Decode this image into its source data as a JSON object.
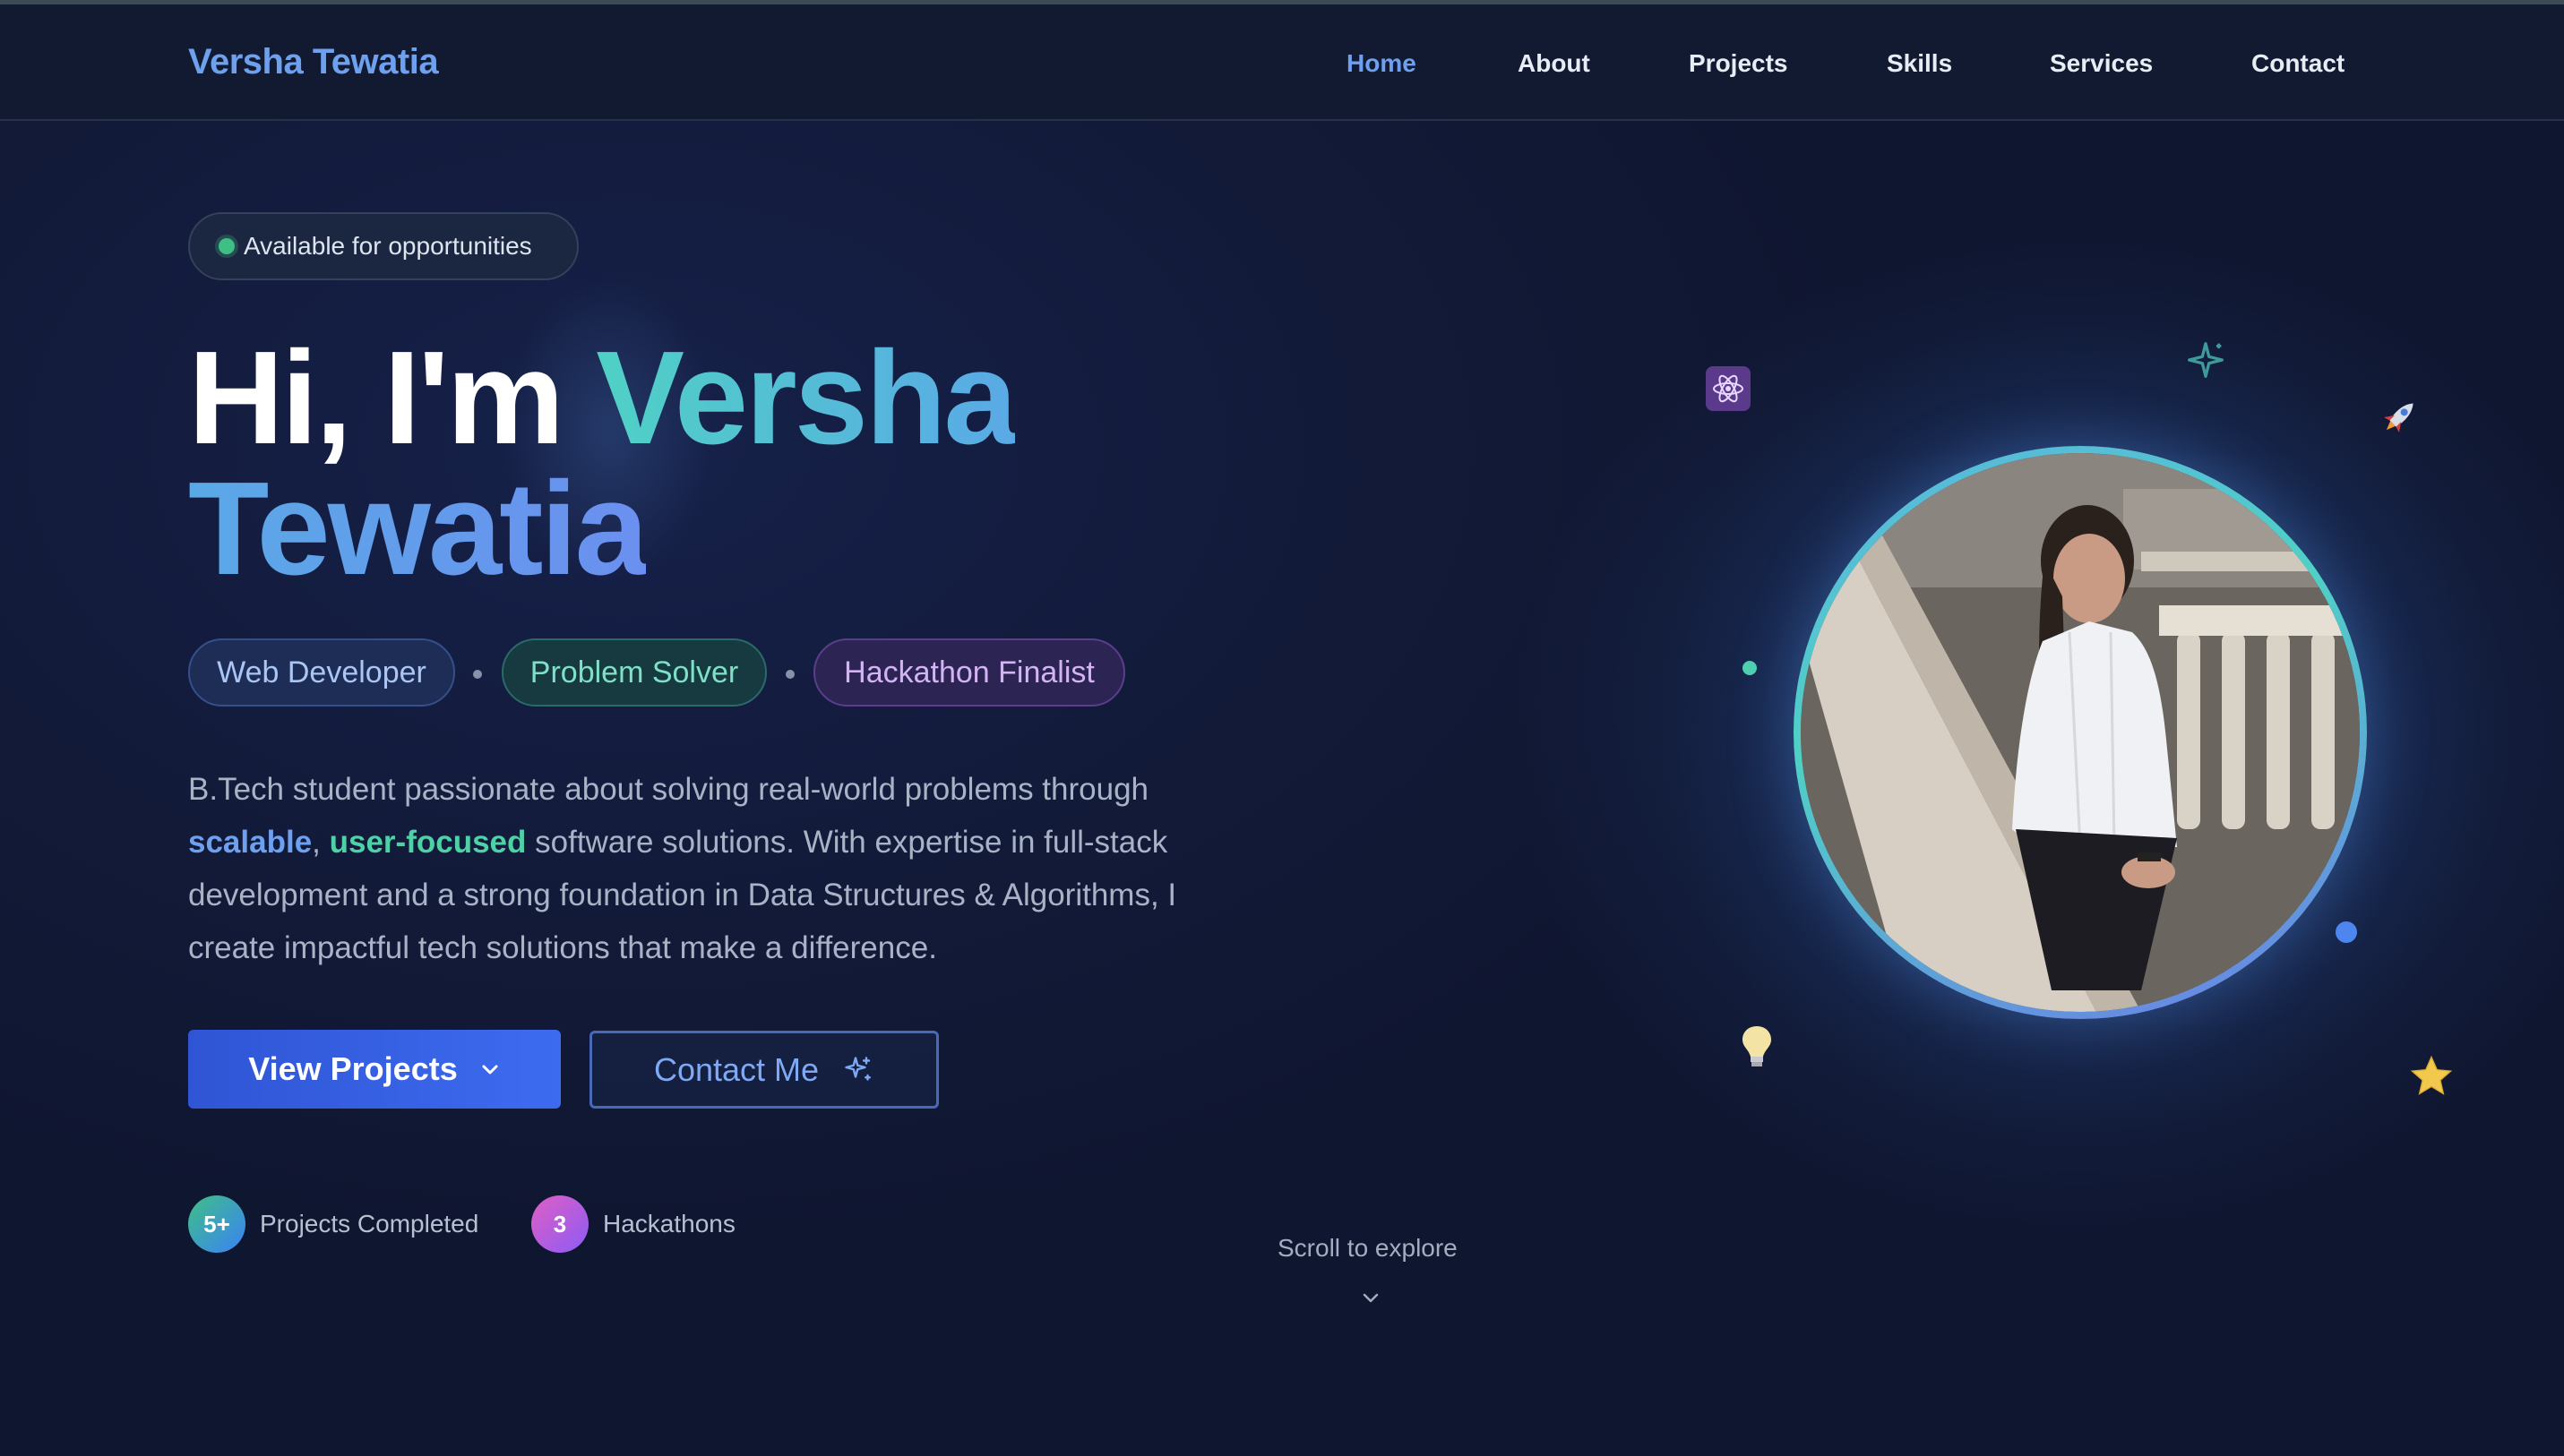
{
  "nav": {
    "brand": "Versha Tewatia",
    "links": [
      {
        "label": "Home",
        "active": true
      },
      {
        "label": "About"
      },
      {
        "label": "Projects"
      },
      {
        "label": "Skills"
      },
      {
        "label": "Services"
      },
      {
        "label": "Contact"
      }
    ]
  },
  "hero": {
    "badge": "Available for opportunities",
    "greeting": "Hi, I'm",
    "name_first": "Versha",
    "name_last": "Tewatia",
    "roles": [
      "Web Developer",
      "Problem Solver",
      "Hackathon Finalist"
    ],
    "description": {
      "part1": "B.Tech student passionate about solving real-world problems through",
      "highlight1": "scalable",
      "comma": ",",
      "highlight2": "user-focused",
      "part2": "software solutions. With expertise in full-stack development and a strong foundation in Data Structures & Algorithms, I create impactful tech solutions that make a difference."
    },
    "buttons": {
      "primary": "View Projects",
      "secondary": "Contact Me"
    },
    "stats": [
      {
        "value": "5+",
        "label": "Projects Completed"
      },
      {
        "value": "3",
        "label": "Hackathons"
      }
    ],
    "scroll_hint": "Scroll to explore"
  },
  "profile": {
    "image_alt": "Profile photo",
    "decorations": [
      "atom-icon",
      "sparkle-icon",
      "rocket-icon",
      "lightbulb-icon",
      "star-icon"
    ]
  },
  "colors": {
    "accent_blue": "#6ea0f0",
    "accent_teal": "#4fd1c5",
    "background": "#111a33"
  }
}
